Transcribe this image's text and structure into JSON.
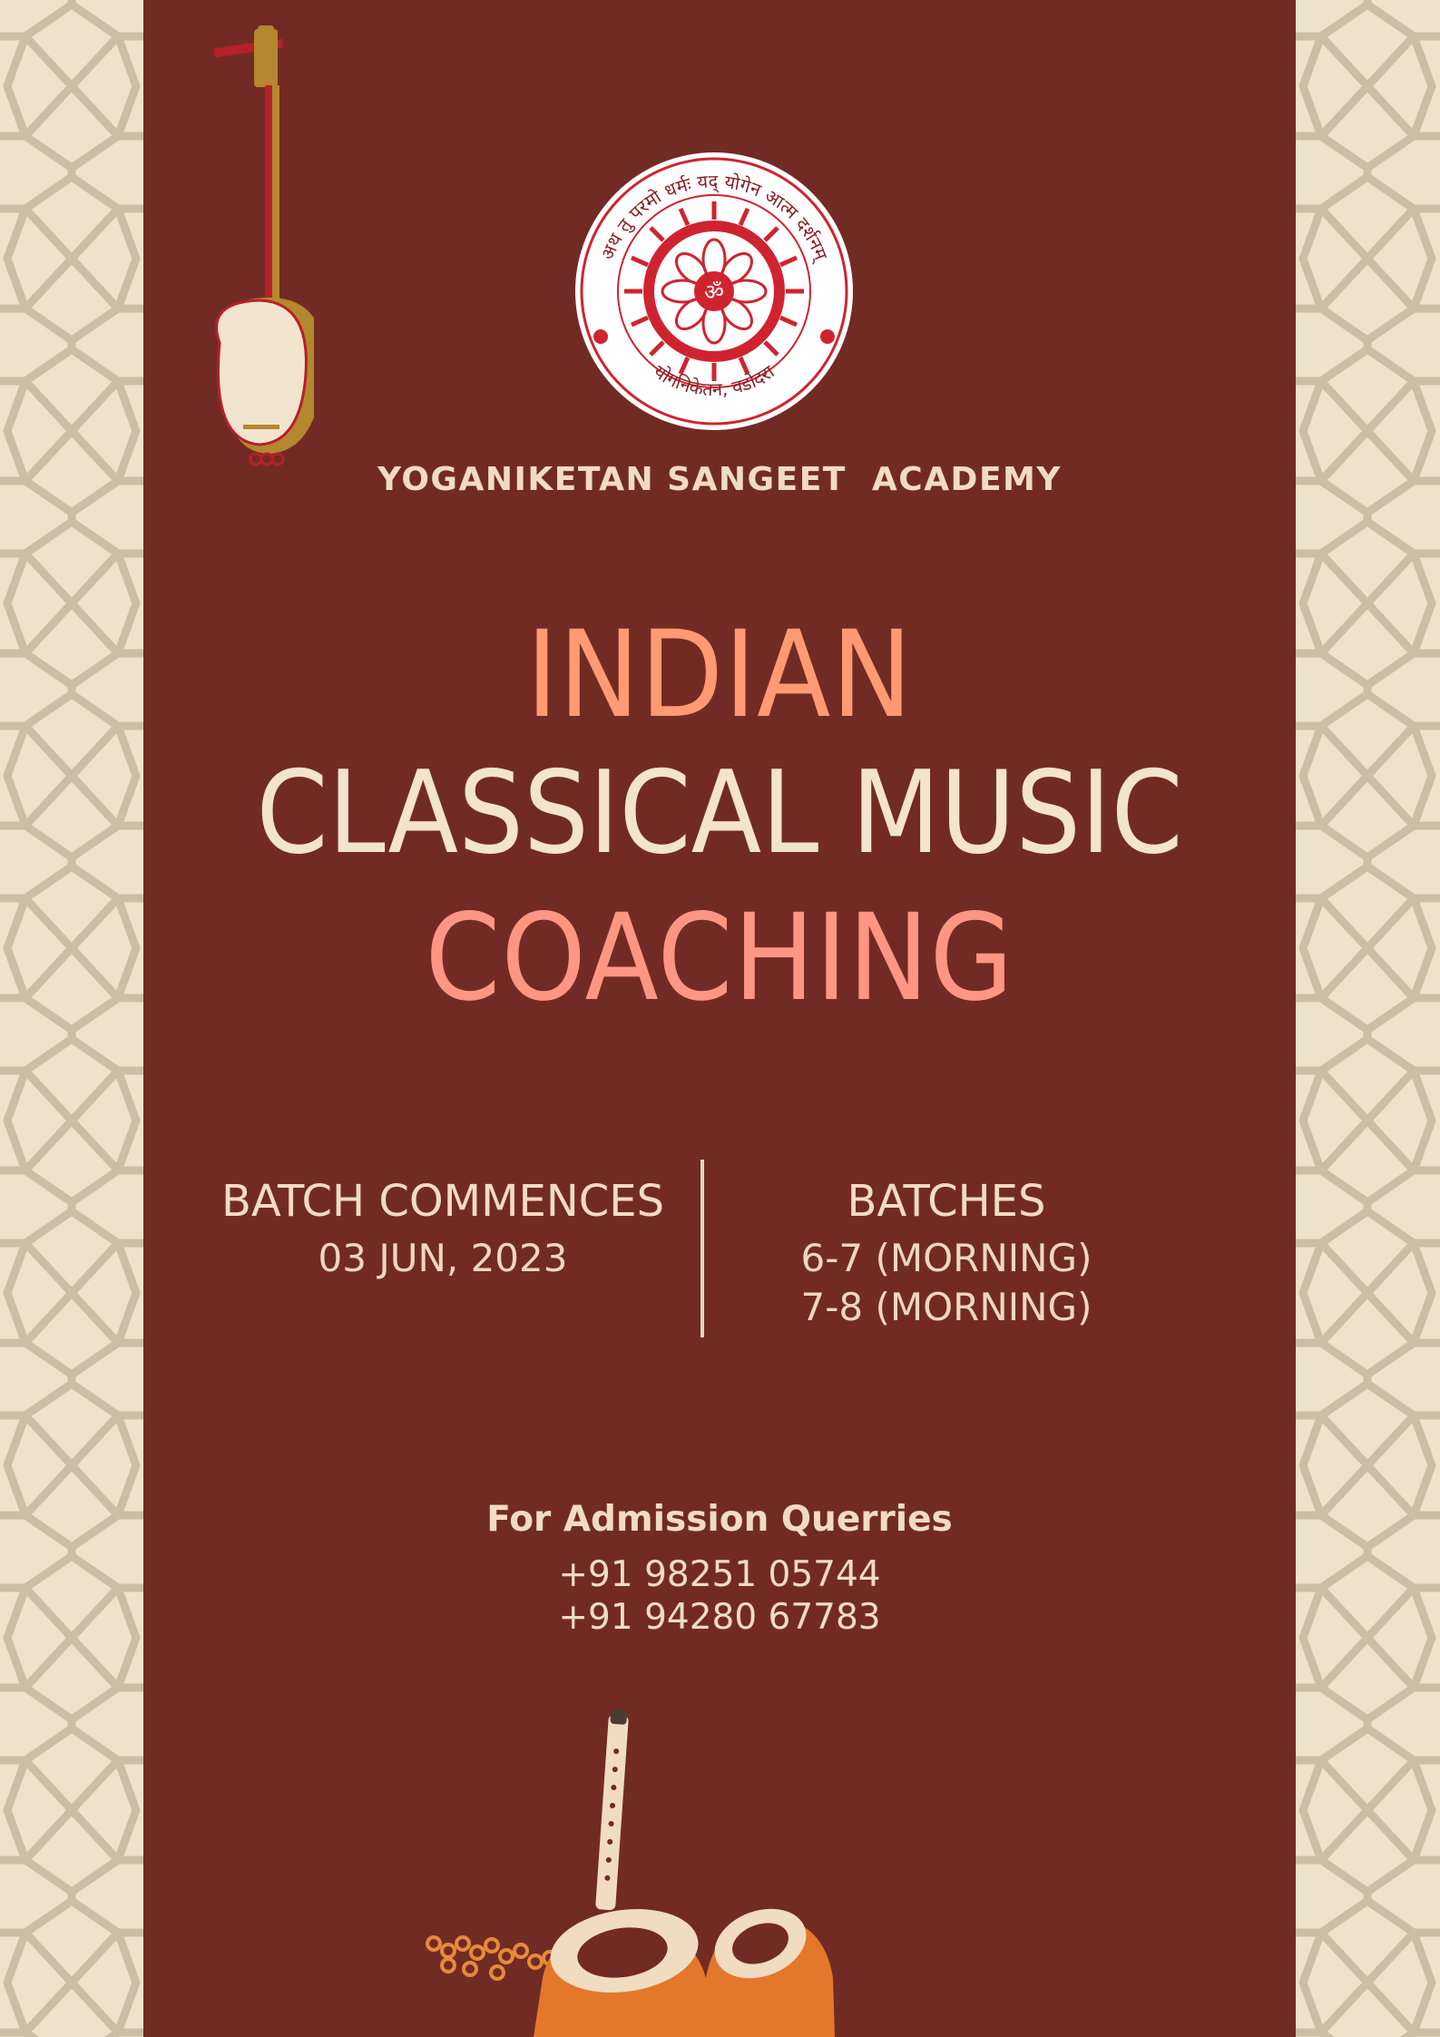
{
  "logo": {
    "arc_text_top": "अथ तु परमो धर्मः यद् योगेन आत्म दर्शनम्",
    "arc_text_bottom": "योगनिकेतन, वडोदरा",
    "center_symbol": "ॐ"
  },
  "academy_name": "YOGANIKETAN SANGEET  ACADEMY",
  "title": {
    "line1": "INDIAN",
    "line2": "CLASSICAL MUSIC",
    "line3": "COACHING"
  },
  "batch_start": {
    "heading": "BATCH COMMENCES",
    "date": "03 JUN, 2023"
  },
  "batches": {
    "heading": "BATCHES",
    "slot1": "6-7 (MORNING)",
    "slot2": "7-8 (MORNING)"
  },
  "contact": {
    "label": "For Admission Querries",
    "phone1": "+91 98251 05744",
    "phone2": "+91 94280 67783"
  },
  "colors": {
    "panel": "#722b24",
    "background": "#efe2cd",
    "accent_orange": "#ff9a72",
    "accent_pink": "#ff9683",
    "cream": "#f2e4cf"
  }
}
